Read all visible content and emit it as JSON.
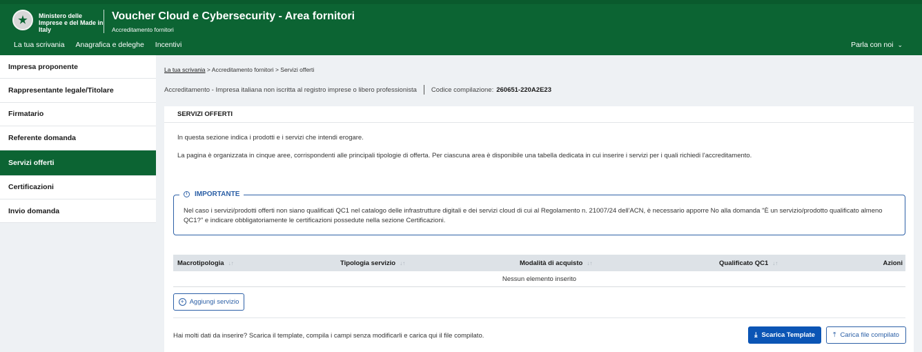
{
  "header": {
    "ministry": "Ministero delle Imprese e del Made in Italy",
    "title": "Voucher Cloud e Cybersecurity - Area fornitori",
    "subtitle": "Accreditamento fornitori",
    "nav": [
      "La tua scrivania",
      "Anagrafica e deleghe",
      "Incentivi"
    ],
    "talk": "Parla con noi",
    "brand_color": "#0c6433"
  },
  "sidebar": {
    "items": [
      {
        "label": "Impresa proponente"
      },
      {
        "label": "Rappresentante legale/Titolare"
      },
      {
        "label": "Firmatario"
      },
      {
        "label": "Referente domanda"
      },
      {
        "label": "Servizi offerti"
      },
      {
        "label": "Certificazioni"
      },
      {
        "label": "Invio domanda"
      }
    ],
    "active": "Servizi offerti"
  },
  "breadcrumb": {
    "home": "La tua scrivania",
    "items": [
      "Accreditamento fornitori",
      "Servizi offerti"
    ],
    "separator": ">"
  },
  "meta": {
    "info": "Accreditamento - Impresa italiana non iscritta al registro imprese o libero professionista",
    "code_label": "Codice compilazione:",
    "code_value": "260651-220A2E23"
  },
  "section": {
    "title": "SERVIZI OFFERTI",
    "intro": "In questa sezione indica i prodotti e i servizi che intendi erogare.",
    "description": "La pagina è organizzata in cinque aree, corrispondenti alle principali tipologie di offerta. Per ciascuna area è disponibile una tabella dedicata in cui inserire i servizi per i quali richiedi l'accreditamento."
  },
  "important": {
    "title": "IMPORTANTE",
    "text": "Nel caso i servizi/prodotti offerti non siano qualificati QC1 nel catalogo delle infrastrutture digitali e dei servizi cloud di cui al Regolamento n. 21007/24 dell'ACN, è necessario apporre No alla domanda \"È un servizio/prodotto qualificato almeno QC1?\" e indicare obbligatoriamente le certificazioni possedute nella sezione Certificazioni."
  },
  "table": {
    "columns": [
      "Macrotipologia",
      "Tipologia servizio",
      "Modalità di acquisto",
      "Qualificato QC1",
      "Azioni"
    ],
    "empty_text": "Nessun elemento inserito"
  },
  "actions": {
    "add_label": "Aggiungi servizio",
    "template_hint": "Hai molti dati da inserire? Scarica il template, compila i campi senza modificarli e carica qui il file compilato.",
    "download_label": "Scarica Template",
    "upload_label": "Carica file compilato",
    "primary_color": "#0b55b5"
  }
}
